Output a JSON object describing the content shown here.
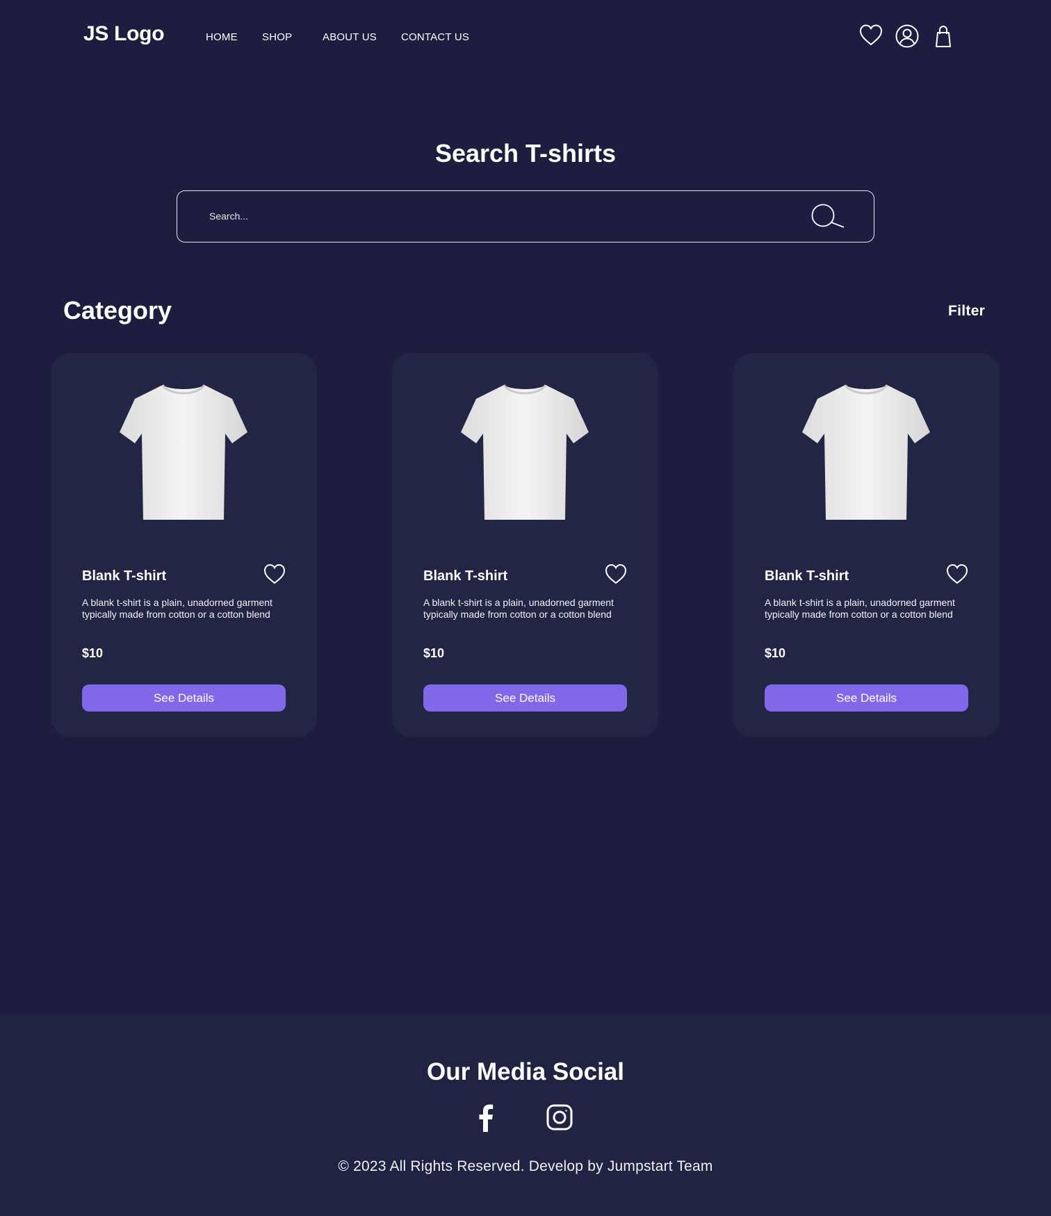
{
  "header": {
    "logo": "JS Logo",
    "nav": [
      "HOME",
      "SHOP",
      "ABOUT US",
      "CONTACT US"
    ],
    "icons": [
      "heart-icon",
      "user-icon",
      "shopping-bag-icon"
    ]
  },
  "search": {
    "title": "Search T-shirts",
    "placeholder": "Search...",
    "icon": "search-icon"
  },
  "category": {
    "title": "Category",
    "filter_label": "Filter"
  },
  "products": [
    {
      "title": "Blank T-shirt",
      "description": "A blank t-shirt is a plain, unadorned garment typically made from cotton or a cotton blend",
      "price": "$10",
      "button": "See Details"
    },
    {
      "title": "Blank T-shirt",
      "description": "A blank t-shirt is a plain, unadorned garment typically made from cotton or a cotton blend",
      "price": "$10",
      "button": "See Details"
    },
    {
      "title": "Blank T-shirt",
      "description": "A blank t-shirt is a plain, unadorned garment typically made from cotton or a cotton blend",
      "price": "$10",
      "button": "See Details"
    }
  ],
  "footer": {
    "title": "Our Media Social",
    "social_icons": [
      "facebook-icon",
      "instagram-icon"
    ],
    "copyright": "© 2023 All Rights Reserved. Develop by Jumpstart Team"
  },
  "colors": {
    "background": "#1d1e3f",
    "card": "#222544",
    "accent": "#8068e8",
    "text": "#ffffff"
  }
}
